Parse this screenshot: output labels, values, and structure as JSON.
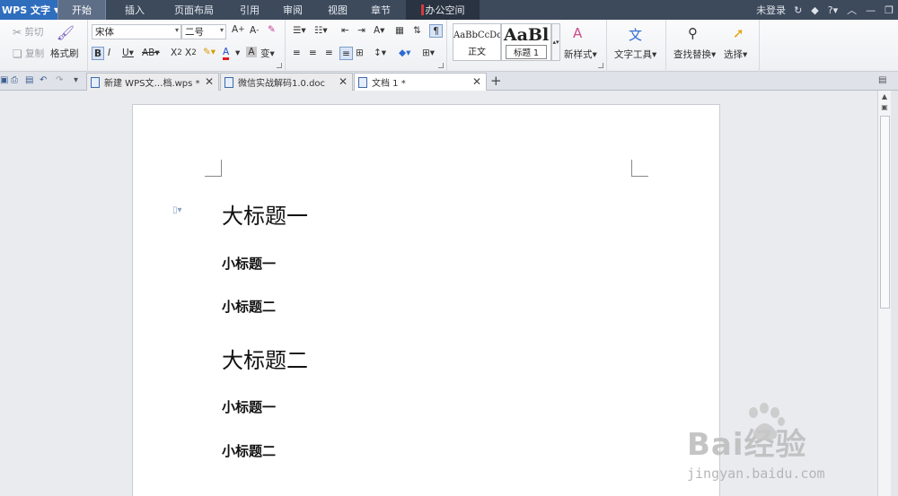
{
  "app": {
    "name": "WPS 文字"
  },
  "menu": {
    "tabs": [
      "开始",
      "插入",
      "页面布局",
      "引用",
      "审阅",
      "视图",
      "章节",
      "办公空间"
    ],
    "active_tab": "开始",
    "login": "未登录"
  },
  "ribbon": {
    "cut": "剪切",
    "copy": "复制",
    "format_painter": "格式刷",
    "font": "宋体",
    "font_size": "二号",
    "style_normal_preview": "AaBbCcDd",
    "style_normal": "正文",
    "style_heading_preview": "AaBl",
    "style_heading": "标题 1",
    "new_style": "新样式",
    "text_tools": "文字工具",
    "find_replace": "查找替换",
    "select": "选择"
  },
  "doc_tabs": [
    {
      "label": "新建 WPS文…档.wps *",
      "active": false
    },
    {
      "label": "微信实战解码1.0.doc",
      "active": false
    },
    {
      "label": "文档 1 *",
      "active": true
    }
  ],
  "document": {
    "lines": [
      {
        "text": "大标题一",
        "level": 1
      },
      {
        "text": "小标题一",
        "level": 2
      },
      {
        "text": "小标题二",
        "level": 2
      },
      {
        "text": "大标题二",
        "level": 1
      },
      {
        "text": "小标题一",
        "level": 2
      },
      {
        "text": "小标题二",
        "level": 2
      }
    ]
  },
  "watermark": {
    "logo": "Bai经验",
    "url": "jingyan.baidu.com"
  },
  "colors": {
    "menubar": "#3d4a5c",
    "app_button": "#2f6dbd",
    "active_tab": "#5e6e86"
  }
}
